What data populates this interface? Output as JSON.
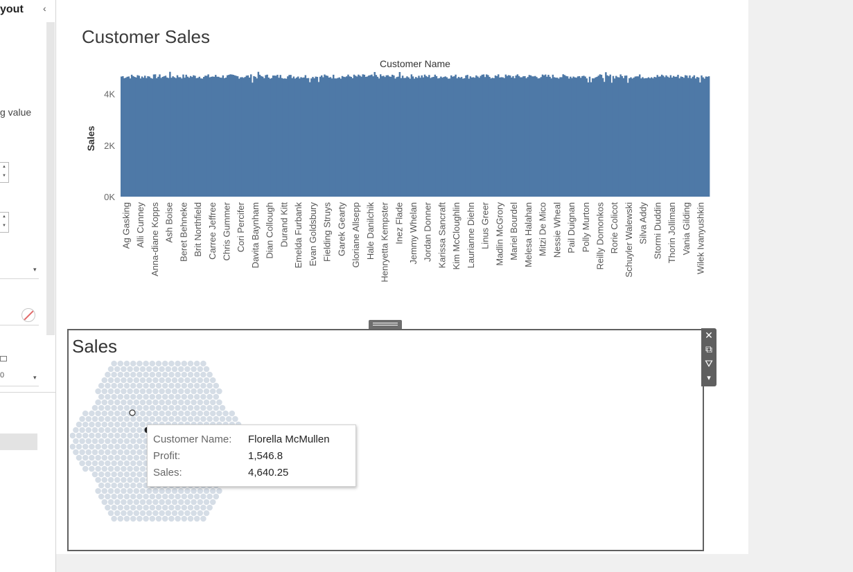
{
  "side_panel": {
    "title": "yout",
    "collapse_icon": "chevron-left-icon",
    "partial_text": "g value",
    "spin_up": "▲",
    "spin_down": "▼",
    "dropdown_arrow": "▾",
    "tiny_value": "0",
    "no_color_icon": "no-color-icon"
  },
  "dashboard": {
    "chart_title": "Customer Sales",
    "panel_title": "Sales",
    "toolbar": {
      "close": "✕",
      "popout": "⧉",
      "filter": "⛛",
      "more": "▾"
    }
  },
  "tooltip": {
    "name_label": "Customer Name:",
    "name_value": "Florella McMullen",
    "profit_label": "Profit:",
    "profit_value": "1,546.8",
    "sales_label": "Sales:",
    "sales_value": "4,640.25"
  },
  "chart_data": {
    "type": "bar",
    "title": "Customer Sales",
    "column_header": "Customer Name",
    "ylabel": "Sales",
    "ylim": [
      0,
      4800
    ],
    "yticks": [
      "0K",
      "2K",
      "4K"
    ],
    "ytick_values": [
      0,
      2000,
      4000
    ],
    "bar_color": "#4e79a7",
    "bar_count": 400,
    "value_min": 4420,
    "value_max": 4880,
    "typical_value": 4680,
    "categories": [
      "Ag Gasking",
      "Alli Cunney",
      "Anna-diane Kopps",
      "Ash Boise",
      "Beret Behneke",
      "Brit Northfield",
      "Carree Jeffree",
      "Chris Gummer",
      "Cori Percifer",
      "Davita Baynham",
      "Dian Collough",
      "Durand Kitt",
      "Emelda Furbank",
      "Evan Goldsbury",
      "Fielding Struys",
      "Garek Gearty",
      "Gloriane Allsepp",
      "Hale Danilchik",
      "Henryetta Kempster",
      "Inez Flade",
      "Jemmy Whelan",
      "Jordan Donner",
      "Karissa Sancraft",
      "Kim McCloughlin",
      "Laurianne Diehn",
      "Linus Greer",
      "Madlin McGrory",
      "Mariel Bourdel",
      "Melesa Halahan",
      "Mitzi De Mico",
      "Nessie Wheal",
      "Pail Duignan",
      "Polly Murton",
      "Reilly Domonkos",
      "Rorie Colicot",
      "Schuyler Walewski",
      "Silva Addy",
      "Stormi Duddin",
      "Thorin Jolliman",
      "Vania Gilding",
      "Wilek Ivanyushkin"
    ]
  },
  "bubble_chart": {
    "type": "packed-bubble",
    "fill_color": "#d5dde6",
    "highlight_stroke": "#333333"
  }
}
